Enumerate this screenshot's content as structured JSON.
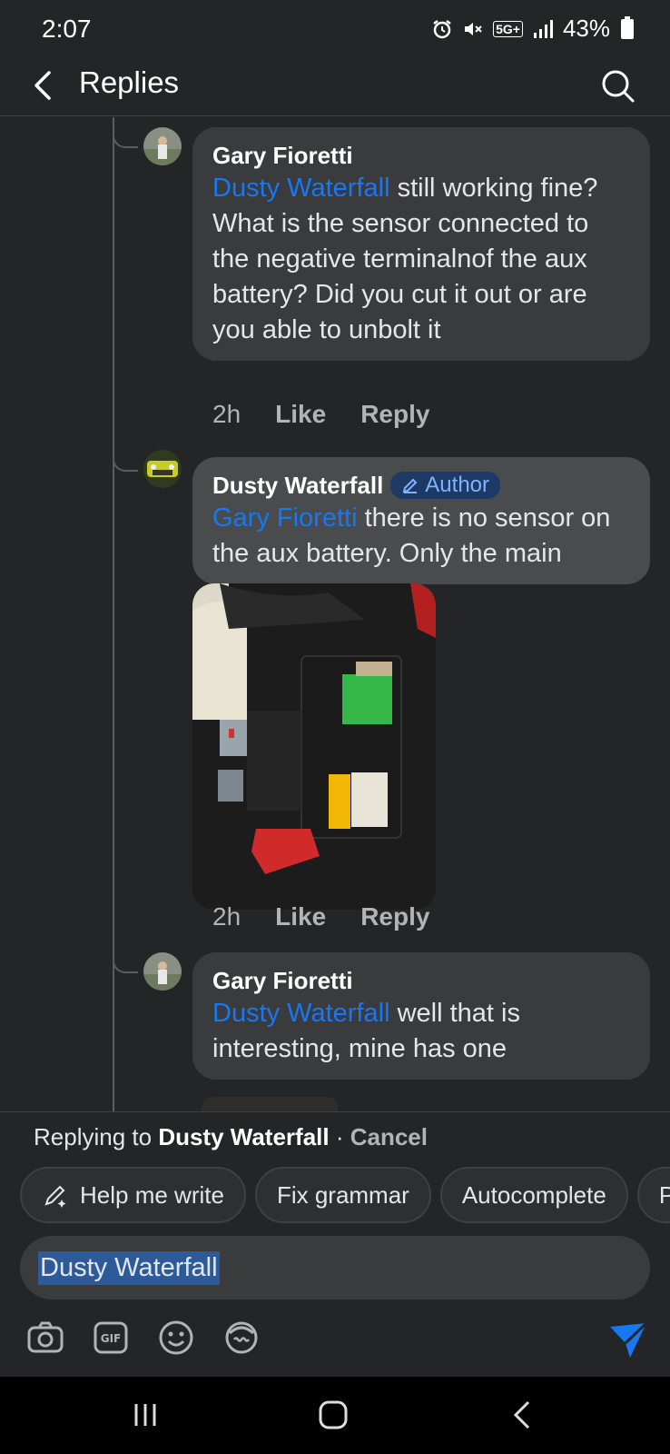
{
  "status_bar": {
    "time": "2:07",
    "network": "5G+",
    "battery": "43%"
  },
  "header": {
    "title": "Replies"
  },
  "comments": [
    {
      "author": "Gary Fioretti",
      "mention": "Dusty Waterfall",
      "text_after_mention_1": " still working fine?",
      "text_2": "What is the sensor connected to the negative terminalnof the aux battery? Did you cut it out or are you able to unbolt it",
      "time": "2h",
      "like": "Like",
      "reply": "Reply"
    },
    {
      "author": "Dusty Waterfall",
      "badge": "Author",
      "mention": "Gary Fioretti",
      "text_after_mention": " there is no sensor on the aux battery. Only the main",
      "time": "2h",
      "like": "Like",
      "reply": "Reply"
    },
    {
      "author": "Gary Fioretti",
      "mention": "Dusty Waterfall",
      "text_after_mention": " well that is interesting, mine has one"
    }
  ],
  "composer": {
    "replying_prefix": "Replying to ",
    "replying_to": "Dusty Waterfall",
    "separator": " · ",
    "cancel": "Cancel",
    "chips": [
      "Help me write",
      "Fix grammar",
      "Autocomplete",
      "P"
    ],
    "input_value": "Dusty Waterfall"
  },
  "colors": {
    "background": "#242526",
    "bubble": "#3a3b3c",
    "mention": "#1877f2",
    "send": "#1877f2"
  }
}
